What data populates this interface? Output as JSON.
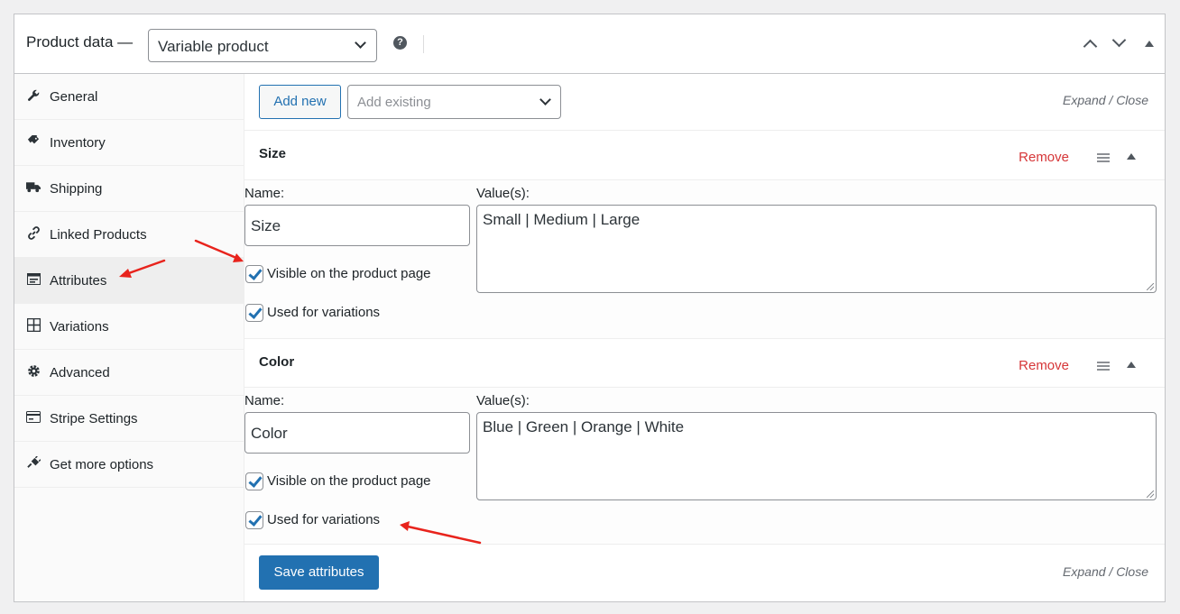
{
  "header": {
    "title": "Product data —",
    "product_type": "Variable product",
    "help_icon": "question-mark-icon"
  },
  "tabs": [
    {
      "label": "General",
      "icon": "wrench-icon"
    },
    {
      "label": "Inventory",
      "icon": "tag-icon"
    },
    {
      "label": "Shipping",
      "icon": "truck-icon"
    },
    {
      "label": "Linked Products",
      "icon": "link-icon"
    },
    {
      "label": "Attributes",
      "icon": "list-card-icon",
      "active": true
    },
    {
      "label": "Variations",
      "icon": "grid-icon"
    },
    {
      "label": "Advanced",
      "icon": "gear-icon"
    },
    {
      "label": "Stripe Settings",
      "icon": "card-icon"
    },
    {
      "label": "Get more options",
      "icon": "plug-icon"
    }
  ],
  "toolbar": {
    "add_new_label": "Add new",
    "add_existing_placeholder": "Add existing",
    "expand_close": "Expand / Close"
  },
  "attributes": [
    {
      "title": "Size",
      "remove_label": "Remove",
      "name_label": "Name:",
      "name_value": "Size",
      "values_label": "Value(s):",
      "values_value": "Small | Medium | Large",
      "visible_label": "Visible on the product page",
      "visible_checked": true,
      "variations_label": "Used for variations",
      "variations_checked": true
    },
    {
      "title": "Color",
      "remove_label": "Remove",
      "name_label": "Name:",
      "name_value": "Color",
      "values_label": "Value(s):",
      "values_value": "Blue | Green | Orange | White",
      "visible_label": "Visible on the product page",
      "visible_checked": true,
      "variations_label": "Used for variations",
      "variations_checked": true
    }
  ],
  "footer": {
    "save_label": "Save attributes",
    "expand_close": "Expand / Close"
  },
  "colors": {
    "accent": "#2271b1",
    "remove": "#d63638",
    "annotation_arrow": "#e8231c"
  }
}
